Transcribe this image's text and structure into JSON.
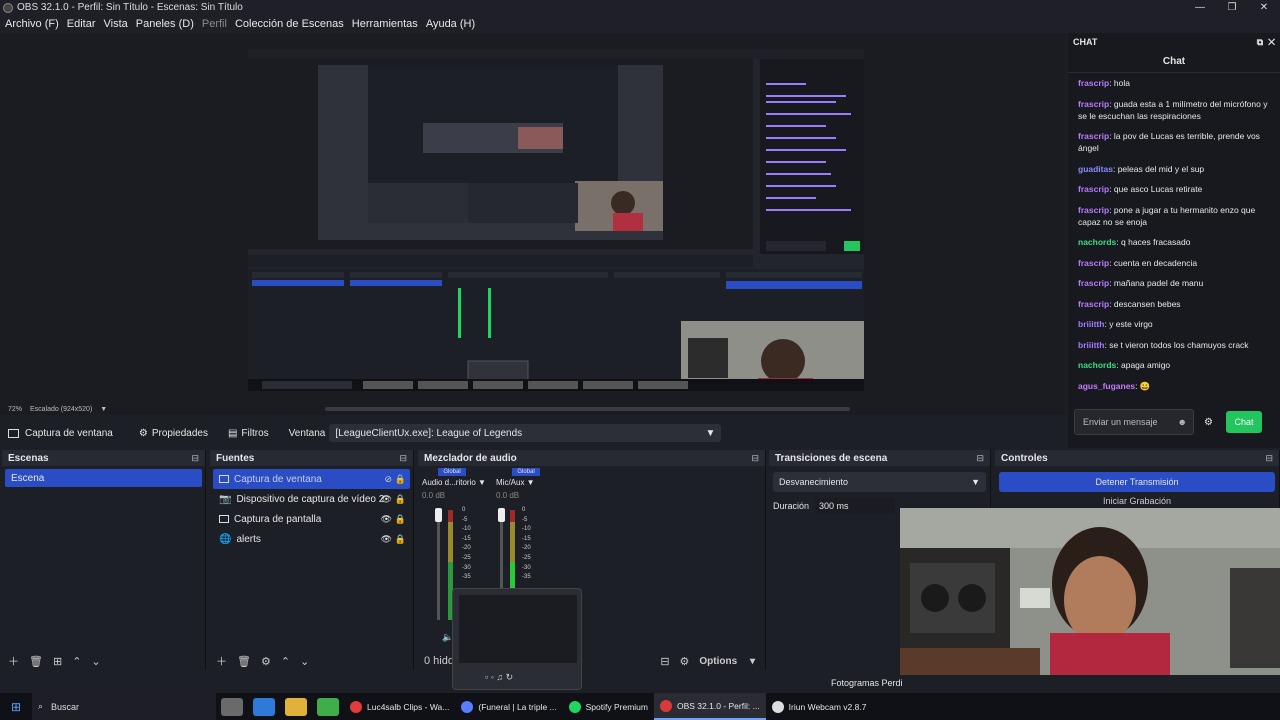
{
  "window": {
    "title": "OBS 32.1.0 - Perfil: Sin Título - Escenas: Sin Título",
    "controls": [
      "—",
      "❐",
      "✕"
    ]
  },
  "menu": [
    {
      "label": "Archivo (F)",
      "dim": false
    },
    {
      "label": "Editar",
      "dim": false
    },
    {
      "label": "Vista",
      "dim": false
    },
    {
      "label": "Paneles (D)",
      "dim": false
    },
    {
      "label": "Perfil",
      "dim": true
    },
    {
      "label": "Colección de Escenas",
      "dim": false
    },
    {
      "label": "Herramientas",
      "dim": false
    },
    {
      "label": "Ayuda (H)",
      "dim": false
    }
  ],
  "preview": {
    "zoom": "72%",
    "scaling": "Escalado (924x520)"
  },
  "toolbar": {
    "source_label": "Captura de ventana",
    "properties": "Propiedades",
    "filters": "Filtros",
    "window_label": "Ventana",
    "window_value": "[LeagueClientUx.exe]: League of Legends"
  },
  "scenes": {
    "title": "Escenas",
    "items": [
      "Escena"
    ]
  },
  "sources": {
    "title": "Fuentes",
    "items": [
      {
        "label": "Captura de ventana",
        "selected": true
      },
      {
        "label": "Dispositivo de captura de vídeo 2",
        "selected": false
      },
      {
        "label": "Captura de pantalla",
        "selected": false
      },
      {
        "label": "alerts",
        "selected": false
      }
    ]
  },
  "mixer": {
    "title": "Mezclador de audio",
    "channels": [
      {
        "global": "Global",
        "name": "Audio d...ritorio",
        "db": "0.0 dB"
      },
      {
        "global": "Global",
        "name": "Mic/Aux",
        "db": "0.0 dB"
      }
    ],
    "scale": [
      "0",
      "-5",
      "-10",
      "-15",
      "-20",
      "-25",
      "-30",
      "-35"
    ],
    "hidden_label": "0 hidd",
    "options": "Options"
  },
  "transitions": {
    "title": "Transiciones de escena",
    "selected": "Desvanecimiento",
    "duration_label": "Duración",
    "duration_value": "300 ms"
  },
  "controls": {
    "title": "Controles",
    "stop_stream": "Detener Transmisión",
    "start_recording": "Iniciar Grabación"
  },
  "status": {
    "frames_dropped": "Fotogramas Perdi"
  },
  "chat": {
    "header": "CHAT",
    "title": "Chat",
    "messages": [
      {
        "user": "frascrip",
        "text": "hola",
        "color": "#b77bff"
      },
      {
        "user": "frascrip",
        "text": "guada esta a 1 milímetro del micrófono y se le escuchan las respiraciones",
        "color": "#b77bff"
      },
      {
        "user": "frascrip",
        "text": "la pov de Lucas es terrible, prende vos ángel",
        "color": "#b77bff"
      },
      {
        "user": "guaditas",
        "text": "peleas del mid y el sup",
        "color": "#8b8bff"
      },
      {
        "user": "frascrip",
        "text": "que asco Lucas retirate",
        "color": "#b77bff"
      },
      {
        "user": "frascrip",
        "text": "pone a jugar a tu hermanito enzo que capaz no se enoja",
        "color": "#b77bff"
      },
      {
        "user": "nachords",
        "text": "q haces fracasado",
        "color": "#3ddc84"
      },
      {
        "user": "frascrip",
        "text": "cuenta en decadencia",
        "color": "#b77bff"
      },
      {
        "user": "frascrip",
        "text": "mañana padel de manu",
        "color": "#b77bff"
      },
      {
        "user": "frascrip",
        "text": "descansen bebes",
        "color": "#b77bff"
      },
      {
        "user": "briiitth",
        "text": "y este virgo",
        "color": "#a27bff"
      },
      {
        "user": "briiitth",
        "text": "se t vieron todos los chamuyos crack",
        "color": "#a27bff"
      },
      {
        "user": "nachords",
        "text": "apaga amigo",
        "color": "#3ddc84"
      },
      {
        "user": "agus_fuganes",
        "text": "😀",
        "color": "#c77bff"
      }
    ],
    "input_placeholder": "Enviar un mensaje",
    "send": "Chat",
    "accent": "#22c55e"
  },
  "taskbar": {
    "search": "Buscar",
    "tasks": [
      {
        "label": "Luc4salb Clips - Wa...",
        "color": "#e23b3b",
        "active": false
      },
      {
        "label": "(Funeral | La triple ...",
        "color": "#5a7cff",
        "active": false
      },
      {
        "label": "Spotify Premium",
        "color": "#1ed760",
        "active": false
      },
      {
        "label": "OBS 32.1.0 - Perfil: ...",
        "color": "#d83a3a",
        "active": true
      },
      {
        "label": "Iriun Webcam v2.8.7",
        "color": "#dddddd",
        "active": false
      }
    ]
  },
  "colors": {
    "accent_blue": "#2a4cc5",
    "panel_bg": "#1d1f26",
    "chat_green": "#22c55e"
  }
}
